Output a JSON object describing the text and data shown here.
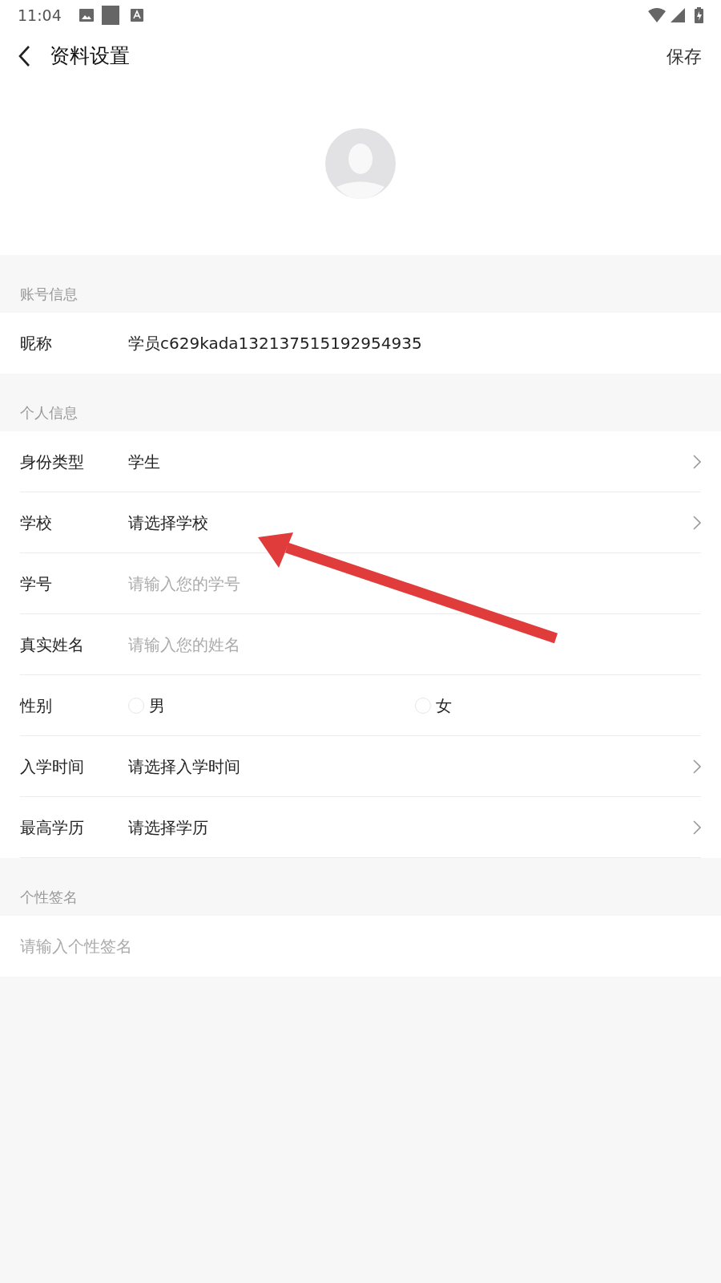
{
  "status_bar": {
    "time": "11:04"
  },
  "header": {
    "title": "资料设置",
    "action": "保存"
  },
  "sections": [
    {
      "title": "账号信息",
      "rows": [
        {
          "kind": "text",
          "label": "昵称",
          "value": "学员c629kada132137515192954935"
        }
      ]
    },
    {
      "title": "个人信息",
      "rows": [
        {
          "kind": "select",
          "label": "身份类型",
          "value": "学生"
        },
        {
          "kind": "select",
          "label": "学校",
          "value": "请选择学校"
        },
        {
          "kind": "input",
          "label": "学号",
          "placeholder": "请输入您的学号"
        },
        {
          "kind": "input",
          "label": "真实姓名",
          "placeholder": "请输入您的姓名"
        },
        {
          "kind": "radio",
          "label": "性别",
          "options": [
            {
              "label": "男",
              "selected": false
            },
            {
              "label": "女",
              "selected": false
            }
          ]
        },
        {
          "kind": "select",
          "label": "入学时间",
          "value": "请选择入学时间"
        },
        {
          "kind": "select",
          "label": "最高学历",
          "value": "请选择学历"
        }
      ]
    },
    {
      "title": "个性签名",
      "rows": [
        {
          "kind": "textarea",
          "placeholder": "请输入个性签名"
        }
      ]
    }
  ]
}
